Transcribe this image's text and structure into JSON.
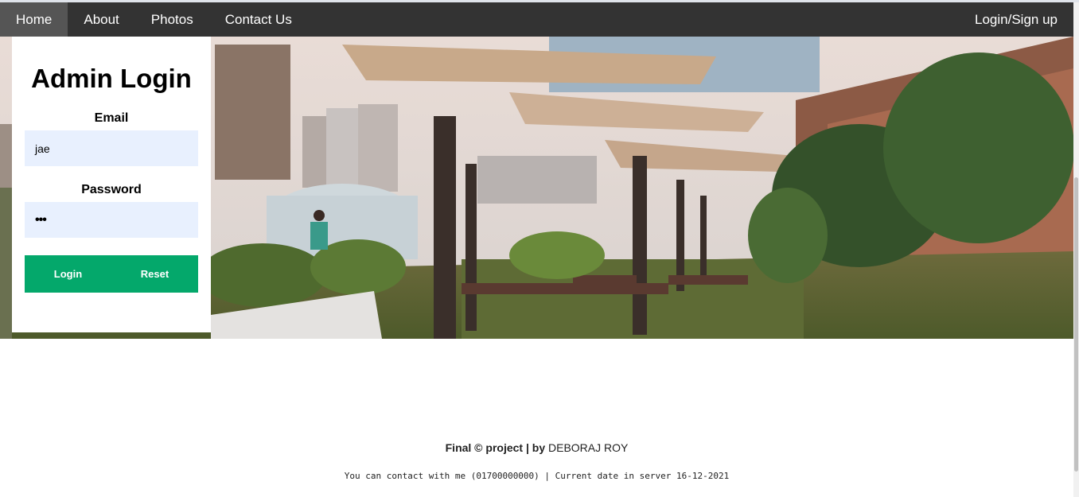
{
  "nav": {
    "items": [
      {
        "label": "Home",
        "active": true
      },
      {
        "label": "About",
        "active": false
      },
      {
        "label": "Photos",
        "active": false
      },
      {
        "label": "Contact Us",
        "active": false
      }
    ],
    "right_label": "Login/Sign up"
  },
  "login": {
    "title": "Admin Login",
    "email_label": "Email",
    "email_value": "jae",
    "password_label": "Password",
    "password_value": "•••",
    "login_button": "Login",
    "reset_button": "Reset"
  },
  "footer": {
    "line1_prefix": "Final © project | by ",
    "line1_name": "DEBORAJ ROY",
    "line2": "You can contact with me (01700000000) | Current date in server 16-12-2021"
  },
  "colors": {
    "navbar": "#333333",
    "nav_active": "#555555",
    "button_green": "#04a86b",
    "input_bg": "#e8f0fe"
  }
}
